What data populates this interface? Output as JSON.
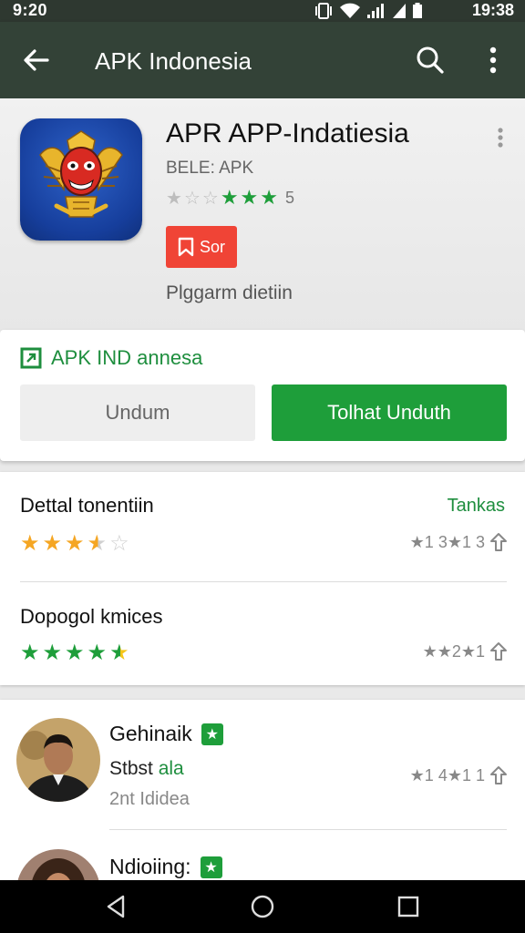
{
  "status_bar": {
    "time_left": "9:20",
    "time_right": "19:38"
  },
  "app_bar": {
    "title": "APK Indonesia"
  },
  "app": {
    "name": "APR APP-Indatiesia",
    "developer": "BELE: APK",
    "rating_count": "5",
    "badge_label": "Sor",
    "subtitle": "Plggarm dietiin",
    "stars_shown": 3
  },
  "install": {
    "verified_label": "APK IND annesa",
    "secondary_button": "Undum",
    "primary_button": "Tolhat Unduth"
  },
  "ratings": [
    {
      "title": "Dettal tonentiin",
      "stars": 3.5,
      "star_color": "#f5a623",
      "stats": "★1 3★1 3",
      "link": "Tankas"
    },
    {
      "title": "Dopogol kmices",
      "stars": 4.5,
      "star_color": "#1e9e3a",
      "stats": "★★2★1",
      "link": ""
    }
  ],
  "reviews": [
    {
      "name": "Gehinaik",
      "line1_a": "Stbst",
      "line1_b": "ala",
      "line2": "2nt Ididea",
      "stats": "★1 4★1 1"
    },
    {
      "name": "Ndioiing:"
    }
  ],
  "colors": {
    "accent_green": "#1e9e3a",
    "app_bar": "#334237",
    "badge_red": "#f04436",
    "star_orange": "#f5a623"
  }
}
